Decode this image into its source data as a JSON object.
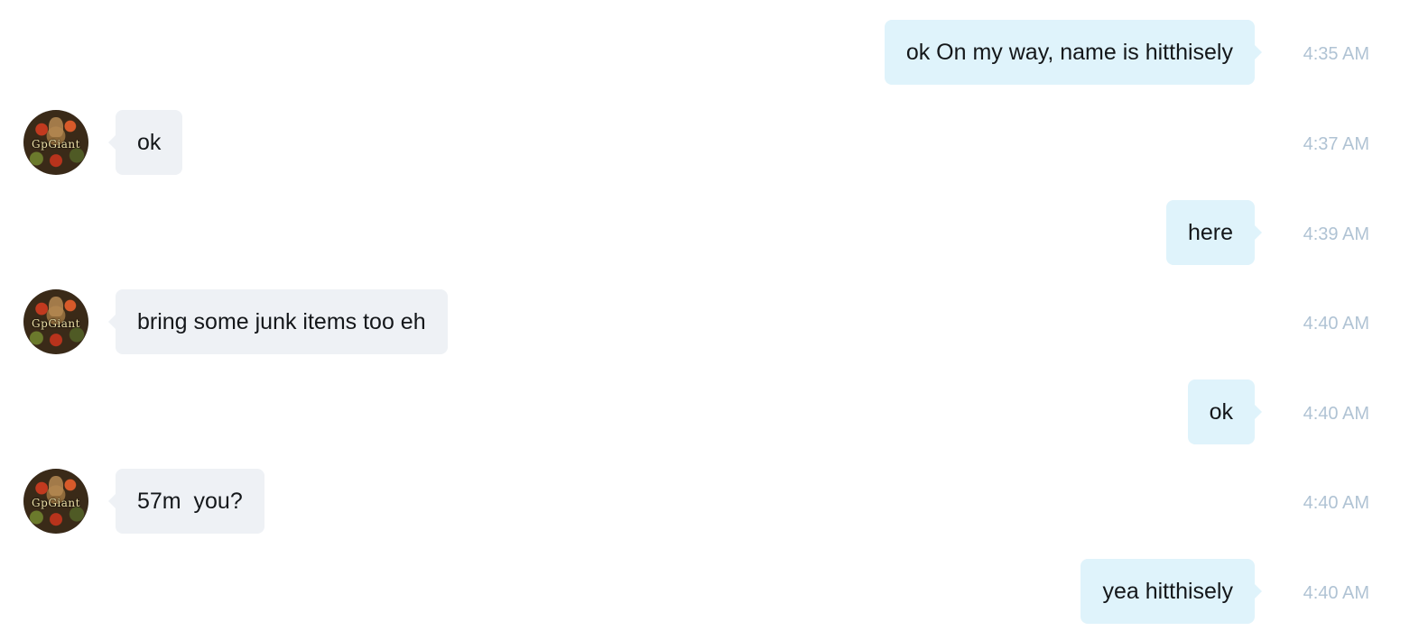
{
  "colors": {
    "incoming_bubble": "#eef1f5",
    "outgoing_bubble": "#dff3fb",
    "timestamp": "#b0c3d4",
    "text": "#14171a"
  },
  "contact": {
    "avatar_text": "GpGiant"
  },
  "messages": [
    {
      "direction": "outgoing",
      "text": "ok On my way, name is hitthisely",
      "time": "4:35 AM"
    },
    {
      "direction": "incoming",
      "text": "ok",
      "time": "4:37 AM"
    },
    {
      "direction": "outgoing",
      "text": "here",
      "time": "4:39 AM"
    },
    {
      "direction": "incoming",
      "text": "bring some junk items too eh",
      "time": "4:40 AM"
    },
    {
      "direction": "outgoing",
      "text": "ok",
      "time": "4:40 AM"
    },
    {
      "direction": "incoming",
      "text": "57m  you?",
      "time": "4:40 AM"
    },
    {
      "direction": "outgoing",
      "text": "yea hitthisely",
      "time": "4:40 AM"
    }
  ]
}
